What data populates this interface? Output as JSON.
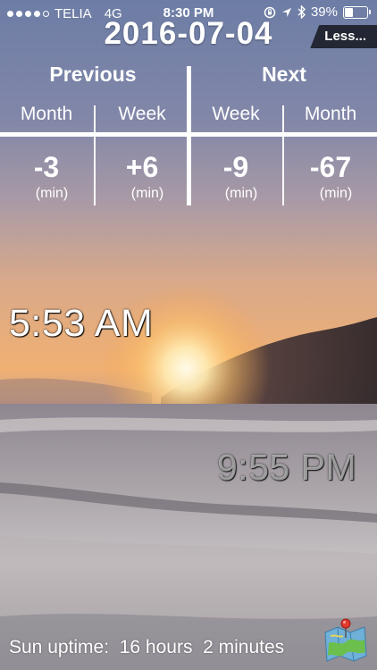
{
  "status_bar": {
    "carrier": "TELIA",
    "network": "4G",
    "time": "8:30 PM",
    "battery": "39%",
    "battery_level": 0.39,
    "icons": [
      "rotation-lock-icon",
      "location-icon",
      "bluetooth-icon",
      "battery-icon"
    ]
  },
  "date": "2016-07-04",
  "less_button": "Less...",
  "previous": {
    "label": "Previous",
    "month": {
      "label": "Month",
      "value": "-3",
      "unit": "(min)"
    },
    "week": {
      "label": "Week",
      "value": "+6",
      "unit": "(min)"
    }
  },
  "next": {
    "label": "Next",
    "week": {
      "label": "Week",
      "value": "-9",
      "unit": "(min)"
    },
    "month": {
      "label": "Month",
      "value": "-67",
      "unit": "(min)"
    }
  },
  "sunrise_time": "5:53 AM",
  "sunset_time": "9:55 PM",
  "uptime": {
    "text": "Sun uptime:  16 hours  2 minutes"
  },
  "map_button_icon": "map-pin-icon"
}
